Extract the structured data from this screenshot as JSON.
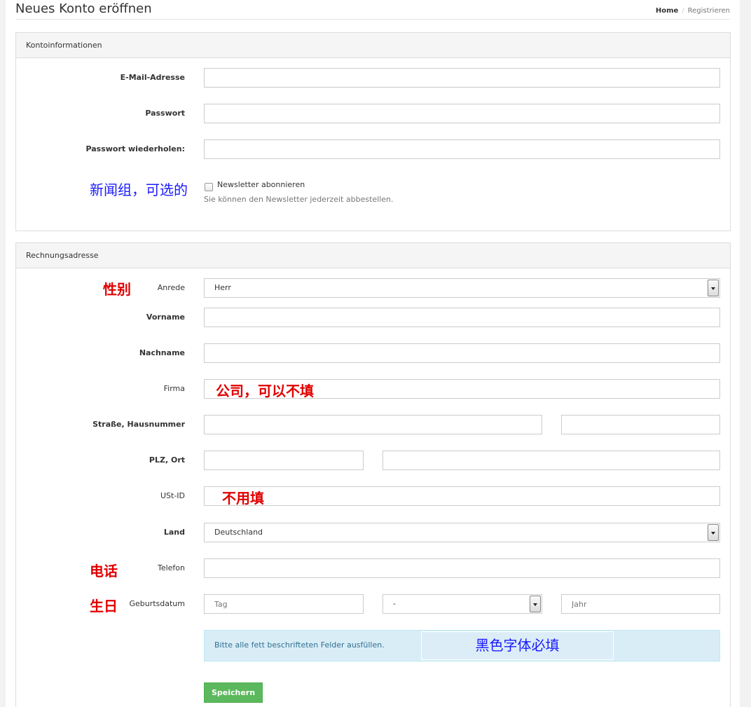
{
  "header": {
    "title": "Neues Konto eröffnen",
    "breadcrumb": {
      "home": "Home",
      "separator": "/",
      "current": "Registrieren"
    }
  },
  "account": {
    "heading": "Kontoinformationen",
    "email_label": "E-Mail-Adresse",
    "password_label": "Passwort",
    "password_repeat_label": "Passwort wiederholen:",
    "newsletter_annotation": "新闻组，可选的",
    "newsletter_label": "Newsletter abonnieren",
    "newsletter_hint": "Sie können den Newsletter jederzeit abbestellen."
  },
  "billing": {
    "heading": "Rechnungsadresse",
    "salutation_annotation": "性别",
    "salutation_label": "Anrede",
    "salutation_value": "Herr",
    "firstname_label": "Vorname",
    "lastname_label": "Nachname",
    "company_label": "Firma",
    "company_annotation": "公司，可以不填",
    "street_label": "Straße, Hausnummer",
    "zip_city_label": "PLZ, Ort",
    "vat_label": "USt-ID",
    "vat_annotation": "不用填",
    "country_label": "Land",
    "country_value": "Deutschland",
    "phone_annotation": "电话",
    "phone_label": "Telefon",
    "birthdate_annotation": "生日",
    "birthdate_label": "Geburtsdatum",
    "day_placeholder": "Tag",
    "month_value": "-",
    "year_placeholder": "Jahr",
    "info_text": "Bitte alle fett beschrifteten Felder ausfüllen.",
    "info_annotation": "黑色字体必填",
    "save_label": "Speichern"
  },
  "colors": {
    "save_button": "#5cb85c",
    "info_background": "#d9edf7",
    "annotation_red": "#e00000",
    "annotation_blue": "#1a1aff"
  }
}
